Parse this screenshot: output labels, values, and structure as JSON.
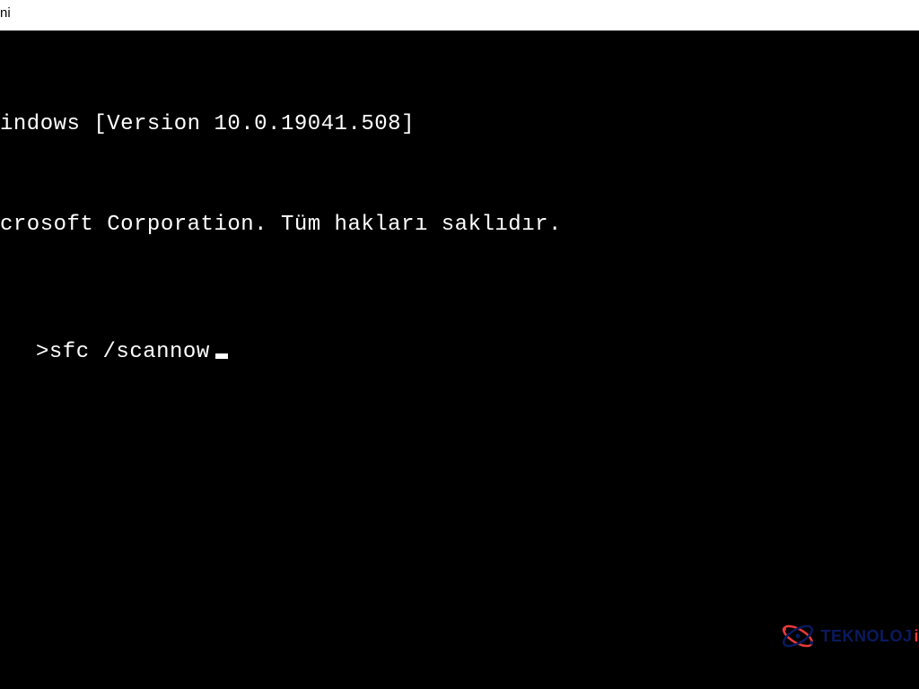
{
  "titlebar": {
    "fragment": "ni"
  },
  "terminal": {
    "line1": "indows [Version 10.0.19041.508]",
    "line2": "crosoft Corporation. Tüm hakları saklıdır.",
    "prompt": ">",
    "command": "sfc /scannow"
  },
  "watermark": {
    "text_main": "TEKNOLOJ",
    "text_accent": "i"
  }
}
